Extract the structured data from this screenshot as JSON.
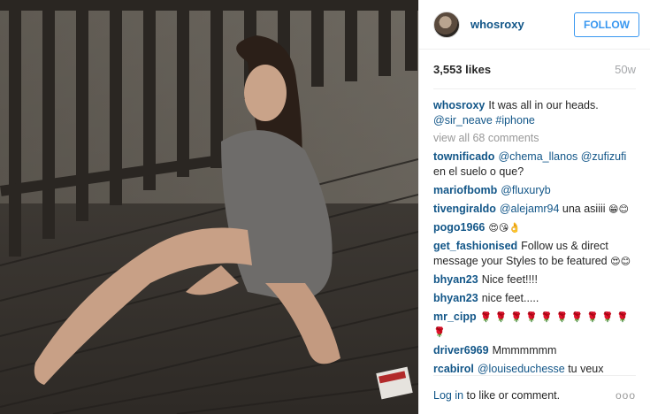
{
  "post": {
    "username": "whosroxy",
    "follow_label": "FOLLOW",
    "likes": "3,553 likes",
    "age": "50w",
    "caption_user": "whosroxy",
    "caption_text": "It was all in our heads.",
    "caption_mentions": "@sir_neave #iphone",
    "view_all": "view all 68 comments"
  },
  "comments": [
    {
      "user": "townificado",
      "mention": "@chema_llanos @zufizufi",
      "text": "en el suelo o que?"
    },
    {
      "user": "mariofbomb",
      "mention": "@fluxuryb",
      "text": ""
    },
    {
      "user": "tivengiraldo",
      "mention": "@alejamr94",
      "text": "una asiiii",
      "emoji": "😁😊"
    },
    {
      "user": "pogo1966",
      "mention": "",
      "text": "",
      "emoji": "😍😘👌"
    },
    {
      "user": "get_fashionised",
      "mention": "",
      "text": "Follow us & direct message your Styles to be featured",
      "emoji": "😍😊"
    },
    {
      "user": "bhyan23",
      "mention": "",
      "text": "Nice feet!!!!"
    },
    {
      "user": "bhyan23",
      "mention": "",
      "text": "nice feet....."
    },
    {
      "user": "mr_cipp",
      "mention": "",
      "text": "",
      "emoji": "🌹 🌹 🌹 🌹 🌹 🌹 🌹 🌹 🌹 🌹 🌹"
    },
    {
      "user": "driver6969",
      "mention": "",
      "text": "Mmmmmmm"
    },
    {
      "user": "rcabirol",
      "mention": "@louiseduchesse",
      "text": "tu veux t'asseoir nue sur un pont où tout le monde a marché dessus ?"
    }
  ],
  "footer": {
    "login_link": "Log in",
    "login_rest": " to like or comment.",
    "more": "ooo"
  },
  "colors": {
    "link": "#125688",
    "follow": "#3897f0",
    "muted": "#a5a7aa"
  }
}
